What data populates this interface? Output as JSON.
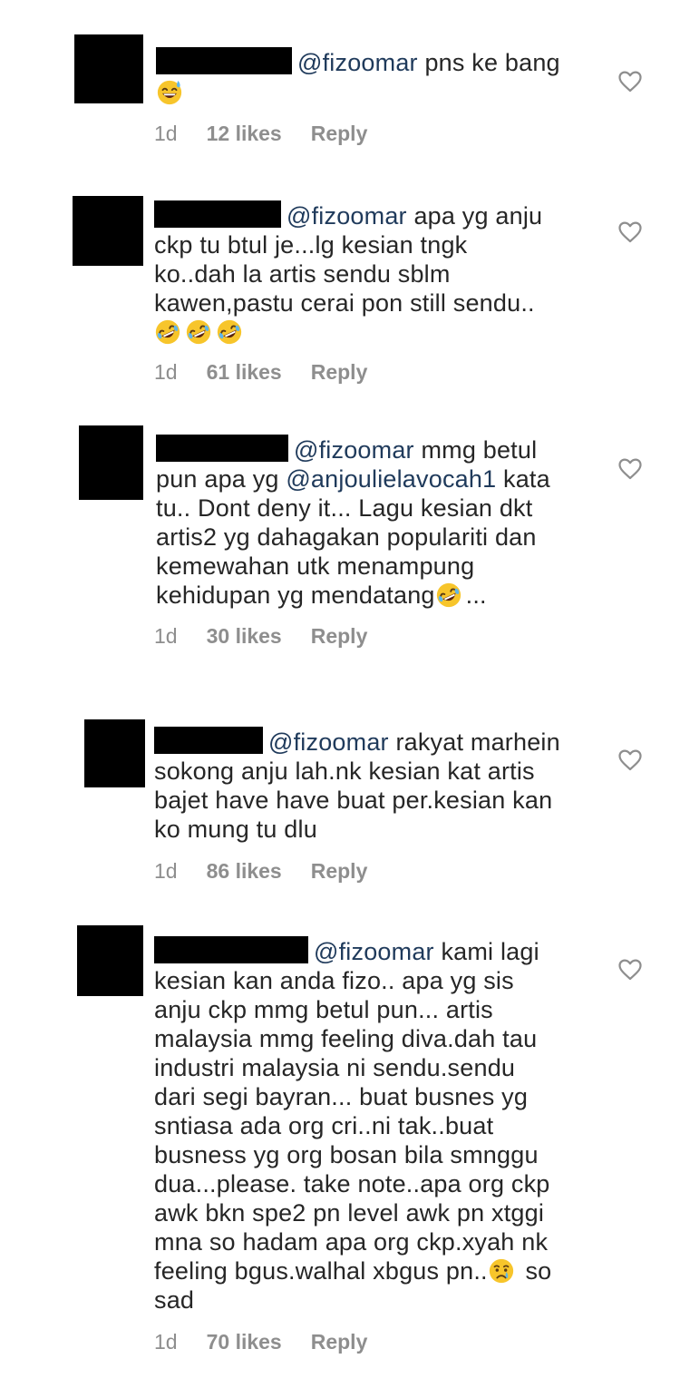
{
  "heart_icon": "heart-outline-icon",
  "comments": [
    {
      "mention": "@fizoomar",
      "text": " pns ke bang",
      "emojis": [
        "grinning-sweat-emoji"
      ],
      "time": "1d",
      "likes": "12 likes",
      "reply": "Reply"
    },
    {
      "mention": "@fizoomar",
      "text_l1": " apa yg anju",
      "text_l2": "ckp tu btul je...lg kesian tngk",
      "text_l3": "ko..dah la artis sendu sblm",
      "text_l4": "kawen,pastu cerai pon still sendu..",
      "emojis": [
        "rofl-emoji",
        "rofl-emoji",
        "rofl-emoji"
      ],
      "time": "1d",
      "likes": "61 likes",
      "reply": "Reply"
    },
    {
      "mention": "@fizoomar",
      "text_l1": " mmg betul",
      "text_l2a": "pun apa yg ",
      "mention2": "@anjoulielavocah1",
      "text_l2b": " kata",
      "text_l3": "tu.. Dont deny it... Lagu kesian dkt",
      "text_l4": "artis2 yg dahagakan populariti dan",
      "text_l5": "kemewahan utk menampung",
      "text_l6a": "kehidupan yg mendatang",
      "text_l6b": "...",
      "emojis": [
        "rofl-emoji"
      ],
      "time": "1d",
      "likes": "30 likes",
      "reply": "Reply"
    },
    {
      "mention": "@fizoomar",
      "text_l1": " rakyat marhein",
      "text_l2": "sokong anju lah.nk kesian kat artis",
      "text_l3": "bajet have have buat per.kesian kan",
      "text_l4": "ko mung tu dlu",
      "time": "1d",
      "likes": "86 likes",
      "reply": "Reply"
    },
    {
      "mention": "@fizoomar",
      "text_l1": " kami lagi",
      "text_l2": "kesian kan anda fizo.. apa yg sis",
      "text_l3": "anju ckp mmg betul pun... artis",
      "text_l4": "malaysia mmg feeling diva.dah tau",
      "text_l5": "industri malaysia ni sendu.sendu",
      "text_l6": "dari segi bayran... buat busnes yg",
      "text_l7": "sntiasa ada org cri..ni tak..buat",
      "text_l8": "busness yg org bosan bila smnggu",
      "text_l9": "dua...please. take note..apa org ckp",
      "text_l10": "awk bkn spe2 pn level awk pn xtggi",
      "text_l11": "mna so hadam apa org ckp.xyah nk",
      "text_l12a": "feeling bgus.walhal xbgus pn..",
      "text_l12b": " so",
      "text_l13": "sad",
      "emojis": [
        "crying-face-emoji"
      ],
      "time": "1d",
      "likes": "70 likes",
      "reply": "Reply"
    }
  ]
}
